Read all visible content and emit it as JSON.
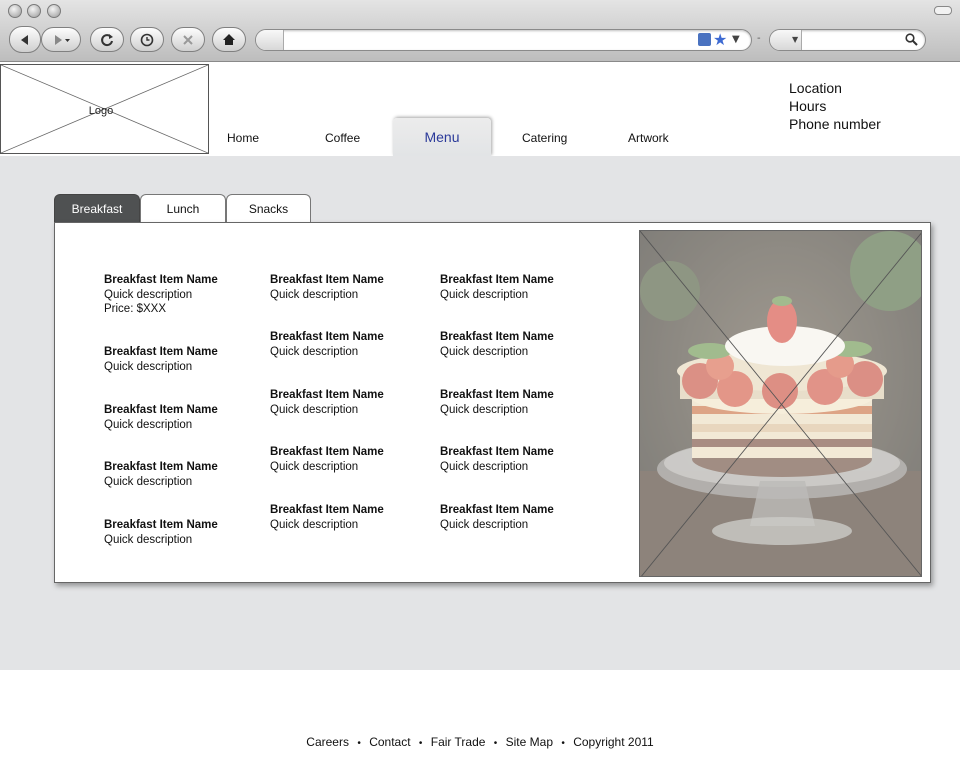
{
  "browser": {
    "address_value": "",
    "search_value": ""
  },
  "site": {
    "logo_label": "Logo",
    "nav": {
      "home": "Home",
      "coffee": "Coffee",
      "menu": "Menu",
      "catering": "Catering",
      "artwork": "Artwork",
      "active": "Menu"
    },
    "contact": {
      "location": "Location",
      "hours": "Hours",
      "phone": "Phone number"
    }
  },
  "menu": {
    "tabs": [
      "Breakfast",
      "Lunch",
      "Snacks"
    ],
    "active_tab": "Breakfast",
    "columns": [
      [
        {
          "name": "Breakfast Item Name",
          "desc": "Quick description",
          "price": "Price: $XXX"
        },
        {
          "name": "Breakfast Item Name",
          "desc": "Quick description"
        },
        {
          "name": "Breakfast Item Name",
          "desc": "Quick description"
        },
        {
          "name": "Breakfast Item Name",
          "desc": "Quick description"
        },
        {
          "name": "Breakfast Item Name",
          "desc": "Quick description"
        }
      ],
      [
        {
          "name": "Breakfast Item Name",
          "desc": "Quick description"
        },
        {
          "name": "Breakfast Item Name",
          "desc": "Quick description"
        },
        {
          "name": "Breakfast Item Name",
          "desc": "Quick description"
        },
        {
          "name": "Breakfast Item Name",
          "desc": "Quick description"
        },
        {
          "name": "Breakfast Item Name",
          "desc": "Quick description"
        }
      ],
      [
        {
          "name": "Breakfast Item Name",
          "desc": "Quick description"
        },
        {
          "name": "Breakfast Item Name",
          "desc": "Quick description"
        },
        {
          "name": "Breakfast Item Name",
          "desc": "Quick description"
        },
        {
          "name": "Breakfast Item Name",
          "desc": "Quick description"
        },
        {
          "name": "Breakfast Item Name",
          "desc": "Quick description"
        }
      ]
    ]
  },
  "footer": {
    "careers": "Careers",
    "contact": "Contact",
    "fair_trade": "Fair Trade",
    "site_map": "Site Map",
    "copyright": "Copyright 2011",
    "separator": "•"
  },
  "colors": {
    "content_bg": "#e3e4e6",
    "active_tab": "#4f5152",
    "nav_active_text": "#2b3a9a"
  }
}
